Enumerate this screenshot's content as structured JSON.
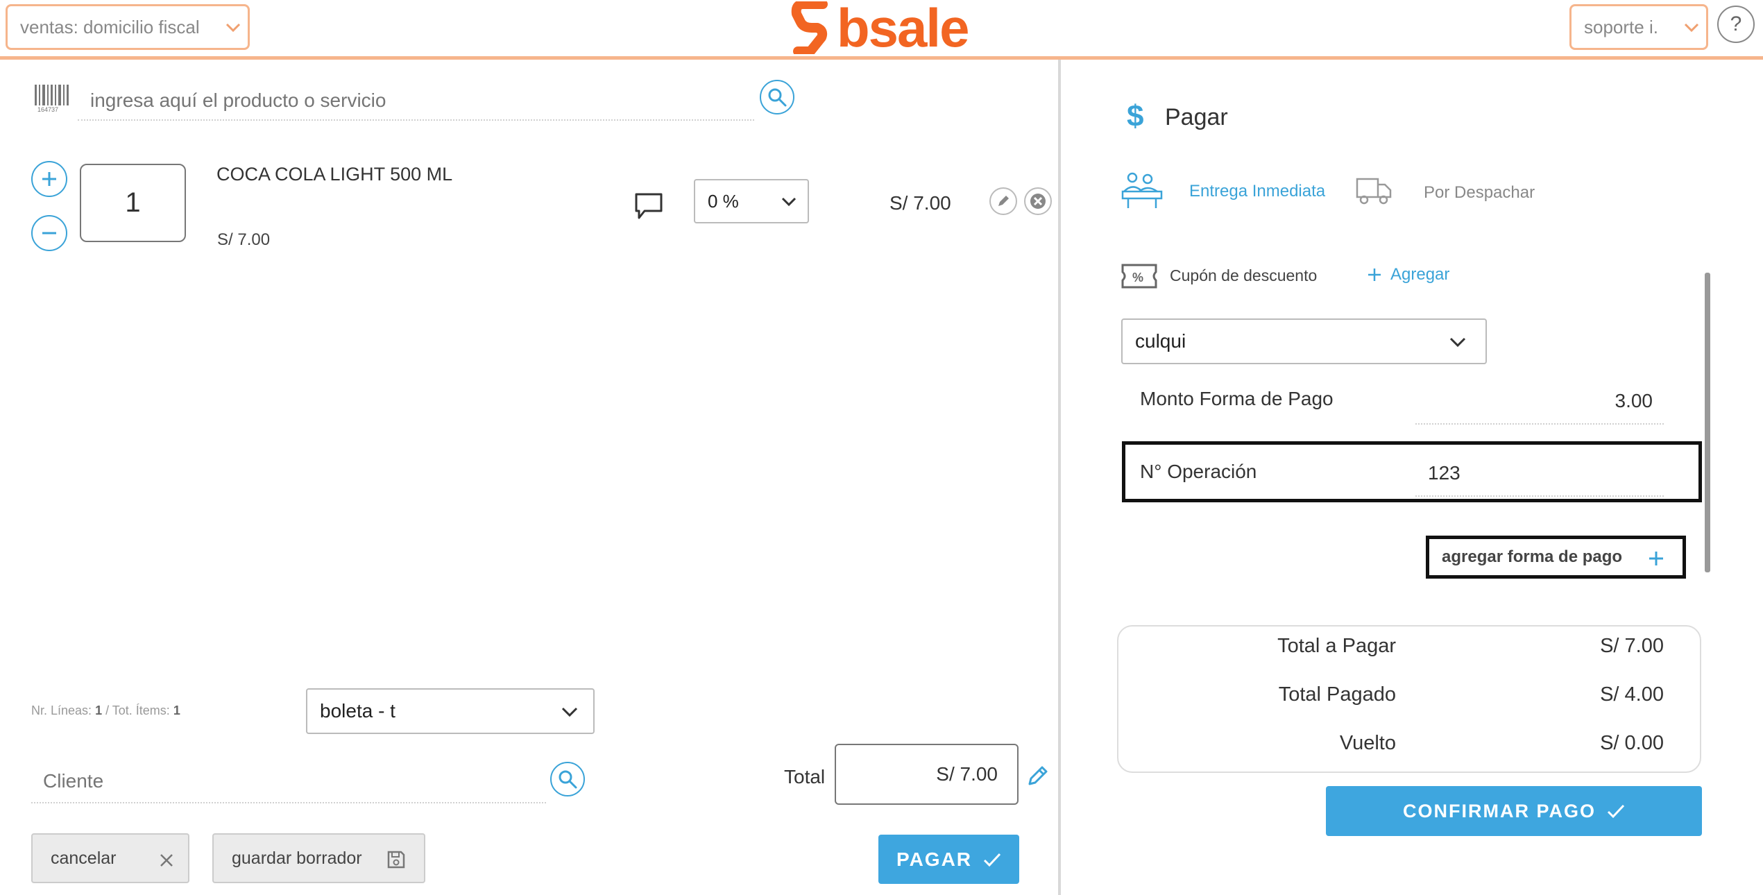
{
  "header": {
    "location_select": "ventas: domicilio fiscal",
    "brand": "bsale",
    "user_select": "soporte i.",
    "help_label": "?"
  },
  "sale": {
    "search_placeholder": "ingresa aquí el producto o servicio",
    "item": {
      "quantity": "1",
      "name": "COCA COLA LIGHT 500 ML",
      "unit_price": "S/ 7.00",
      "discount": "0 %",
      "line_total": "S/ 7.00"
    },
    "summary_lines_label": "Nr. Líneas:",
    "summary_lines_value": "1",
    "summary_items_label": "/ Tot. Ítems:",
    "summary_items_value": "1",
    "document_type": "boleta - t",
    "client_placeholder": "Cliente",
    "total_label": "Total",
    "total_value": "S/ 7.00",
    "cancel_label": "cancelar",
    "draft_label": "guardar borrador",
    "pay_label": "PAGAR"
  },
  "payment": {
    "title": "Pagar",
    "delivery_immediate": "Entrega Inmediata",
    "delivery_dispatch": "Por Despachar",
    "coupon_label": "Cupón de descuento",
    "coupon_add": "Agregar",
    "method": "culqui",
    "amount_label": "Monto Forma de Pago",
    "amount_value": "3.00",
    "operation_label": "N° Operación",
    "operation_value": "123",
    "add_method_label": "agregar forma de pago",
    "totals": [
      {
        "label": "Total a Pagar",
        "value": "S/ 7.00"
      },
      {
        "label": "Total Pagado",
        "value": "S/ 4.00"
      },
      {
        "label": "Vuelto",
        "value": "S/ 0.00"
      }
    ],
    "confirm_label": "CONFIRMAR PAGO"
  },
  "colors": {
    "brand_orange": "#f26522",
    "accent_blue": "#3ea6df",
    "header_border": "#f6b58c"
  }
}
